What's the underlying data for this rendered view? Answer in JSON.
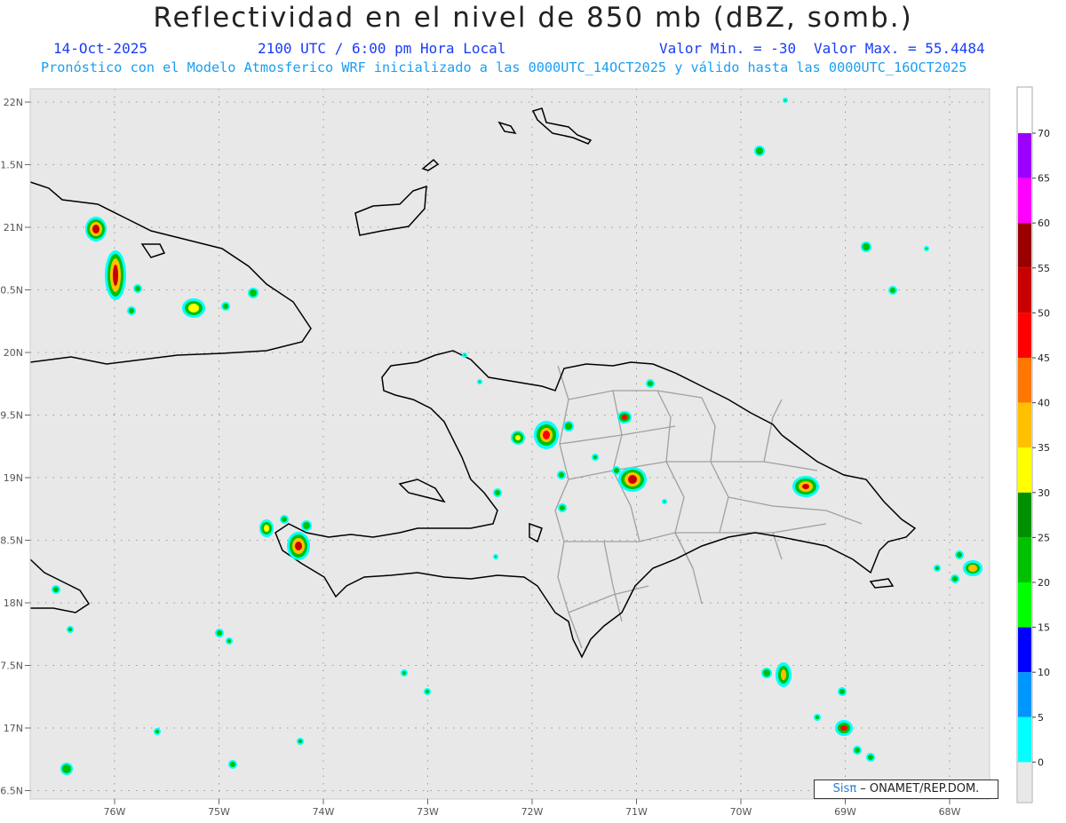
{
  "header": {
    "title": "Reflectividad en el nivel de 850 mb (dBZ, somb.)",
    "date": "14-Oct-2025",
    "time": "2100 UTC / 6:00 pm Hora Local",
    "valmin": "Valor Min. = -30",
    "valmax": "Valor Max. = 55.4484",
    "forecast": "Pronóstico con el Modelo Atmosferico WRF inicializado a las 0000UTC_14OCT2025 y válido hasta las 0000UTC_16OCT2025"
  },
  "axes": {
    "lat_labels": [
      "22N",
      "1.5N",
      "21N",
      "0.5N",
      "20N",
      "9.5N",
      "19N",
      "8.5N",
      "18N",
      "7.5N",
      "17N",
      "6.5N"
    ],
    "lat_values": [
      22,
      21.5,
      21,
      20.5,
      20,
      19.5,
      19,
      18.5,
      18,
      17.5,
      17,
      16.5
    ],
    "lon_labels": [
      "76W",
      "75W",
      "74W",
      "73W",
      "72W",
      "71W",
      "70W",
      "69W",
      "68W"
    ],
    "lon_values": [
      -76,
      -75,
      -74,
      -73,
      -72,
      -71,
      -70,
      -69,
      -68
    ]
  },
  "colorbar": {
    "labels": [
      "70",
      "65",
      "60",
      "55",
      "50",
      "45",
      "40",
      "35",
      "30",
      "25",
      "20",
      "15",
      "10",
      "5",
      "0"
    ],
    "colors": [
      "#9b00ff",
      "#ff00ff",
      "#9a0000",
      "#c80000",
      "#ff0000",
      "#ff7700",
      "#ffc000",
      "#ffff00",
      "#009000",
      "#00c000",
      "#00ff00",
      "#0000ff",
      "#0096ff",
      "#00ffff"
    ]
  },
  "credit": {
    "sis": "Sis",
    "pi": "π",
    "rest": "– ONAMET/REP.DOM."
  },
  "colors": {
    "background": "#e8e8e8",
    "coast": "#000000",
    "border": "#a0a0a0"
  }
}
